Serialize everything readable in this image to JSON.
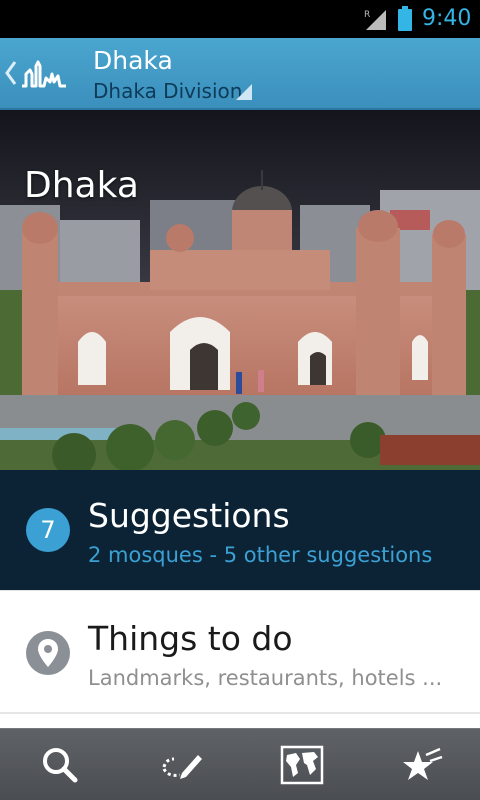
{
  "status_bar": {
    "time": "9:40",
    "network_indicator": "R"
  },
  "action_bar": {
    "title": "Dhaka",
    "subtitle": "Dhaka Division",
    "icons": {
      "up": "chevron-left-icon",
      "logo": "skyline-logo-icon",
      "dropdown": "dropdown-triangle-icon"
    }
  },
  "hero": {
    "title": "Dhaka"
  },
  "suggestions": {
    "count": "7",
    "title": "Suggestions",
    "subtitle": "2 mosques - 5 other suggestions"
  },
  "things_to_do": {
    "title": "Things to do",
    "subtitle": "Landmarks, restaurants, hotels ..."
  },
  "toolbar": {
    "items": [
      "search-icon",
      "edit-route-icon",
      "world-map-icon",
      "favorites-star-icon"
    ]
  },
  "colors": {
    "accent": "#33b5e5",
    "action_bar": "#4aa6cf",
    "suggestions_bg": "#0b2335",
    "badge": "#3ba1d4"
  }
}
